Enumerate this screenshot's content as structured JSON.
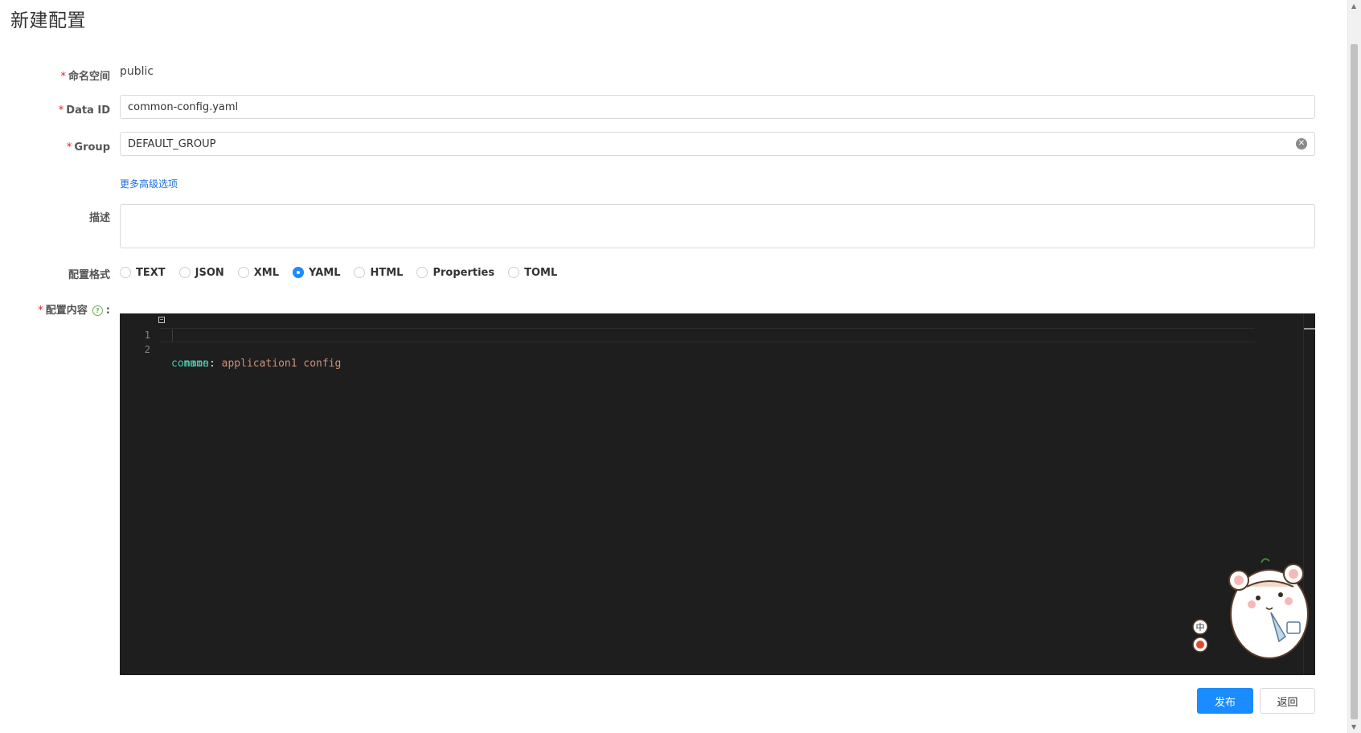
{
  "page": {
    "title": "新建配置"
  },
  "form": {
    "namespace": {
      "label": "命名空间",
      "value": "public"
    },
    "data_id": {
      "label": "Data ID",
      "value": "common-config.yaml"
    },
    "group": {
      "label": "Group",
      "value": "DEFAULT_GROUP"
    },
    "advanced_link": "更多高级选项",
    "description": {
      "label": "描述",
      "value": ""
    },
    "format": {
      "label": "配置格式",
      "options": [
        "TEXT",
        "JSON",
        "XML",
        "YAML",
        "HTML",
        "Properties",
        "TOML"
      ],
      "selected": "YAML"
    },
    "content": {
      "label": "配置内容",
      "colon": ":",
      "lines": [
        {
          "no": "1",
          "key": "common",
          "punc": ":",
          "value": ""
        },
        {
          "no": "2",
          "key": "  name",
          "punc": ": ",
          "value": "application1 config"
        }
      ]
    }
  },
  "sticker": {
    "badge_1": "中"
  },
  "buttons": {
    "publish": "发布",
    "back": "返回"
  },
  "colors": {
    "primary": "#1a8cff",
    "required": "#e02020",
    "editor_bg": "#1e1e1e"
  }
}
